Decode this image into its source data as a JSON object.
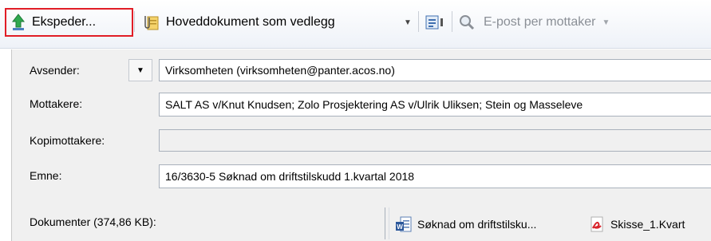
{
  "toolbar": {
    "send_label": "Ekspeder...",
    "main_doc_label": "Hoveddokument som vedlegg",
    "email_per_recipient_label": "E-post per mottaker"
  },
  "form": {
    "sender_label": "Avsender:",
    "sender_value": "Virksomheten (virksomheten@panter.acos.no)",
    "recipients_label": "Mottakere:",
    "recipients_value": "SALT AS v/Knut Knudsen; Zolo Prosjektering AS v/Ulrik Uliksen; Stein og Masseleve",
    "cc_label": "Kopimottakere:",
    "cc_value": "",
    "subject_label": "Emne:",
    "subject_value": "16/3630-5 Søknad om driftstilskudd 1.kvartal 2018",
    "documents_label": "Dokumenter (374,86 KB):"
  },
  "attachments": [
    {
      "name": "Søknad om driftstilsku...",
      "icon": "word-doc-icon"
    },
    {
      "name": "Skisse_1.Kvart",
      "icon": "pdf-icon"
    }
  ],
  "colors": {
    "highlight": "#e11d26",
    "panel_bg": "#f0f0f0",
    "disabled_text": "#8a8f96"
  }
}
